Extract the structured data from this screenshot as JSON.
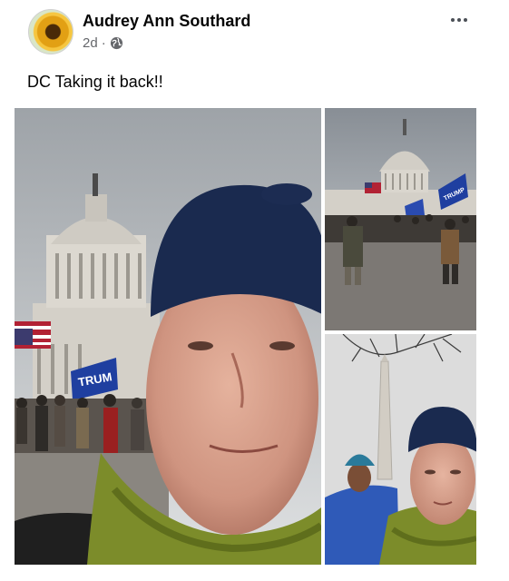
{
  "post": {
    "author": "Audrey Ann Southard",
    "time": "2d",
    "separator": "·",
    "text": "DC Taking it back!!",
    "audience_icon": "globe-icon",
    "menu_icon": "more-options-icon"
  },
  "photos": {
    "main_sign_text": "TRUM",
    "top_right_flag_text": "TRUMP"
  },
  "colors": {
    "meta_gray": "#65676b",
    "author_black": "#050505"
  }
}
